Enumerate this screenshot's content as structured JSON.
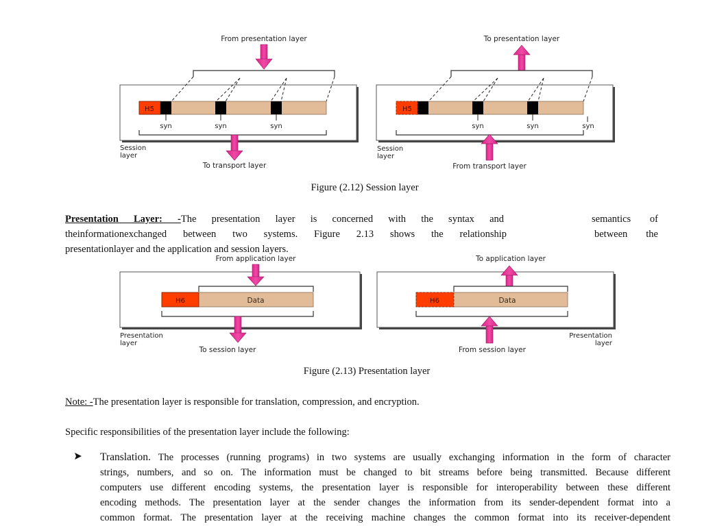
{
  "figure_2_12": {
    "left": {
      "top_label": "From presentation layer",
      "bottom_label": "To transport layer",
      "box_label_line1": "Session",
      "box_label_line2": "layer",
      "header": "H5",
      "syn_labels": [
        "syn",
        "syn",
        "syn"
      ]
    },
    "right": {
      "top_label": "To presentation layer",
      "bottom_label": "From transport layer",
      "box_label_line1": "Session",
      "box_label_line2": "layer",
      "header": "H5",
      "syn_labels": [
        "syn",
        "syn",
        "syn"
      ]
    },
    "caption": "Figure (2.12) Session layer"
  },
  "presentation_paragraph": {
    "heading": "Presentation Layer: -",
    "line1_a": "The presentation layer is concerned with the syntax and",
    "line1_b": "semantics of",
    "line2_a": "theinformationexchanged between two systems. Figure 2.13 shows the relationship",
    "line2_b": "between the",
    "line3": "presentationlayer and the application and session layers."
  },
  "figure_2_13": {
    "left": {
      "top_label": "From application layer",
      "bottom_label": "To session layer",
      "box_label_line1": "Presentation",
      "box_label_line2": "layer",
      "header": "H6",
      "data": "Data"
    },
    "right": {
      "top_label": "To application layer",
      "bottom_label": "From session layer",
      "box_label_line1": "Presentation",
      "box_label_line2": "layer",
      "header": "H6",
      "data": "Data"
    },
    "caption": "Figure (2.13) Presentation layer"
  },
  "note": {
    "label": "Note: -",
    "text": "The presentation layer is responsible for translation, compression, and encryption."
  },
  "responsibilities_intro": "Specific responsibilities of the presentation layer include the following:",
  "bullets": [
    {
      "icon": "arrowhead-bullet-icon",
      "title": "Translation.",
      "lines": [
        "The processes (running programs) in two systems are usually exchanging information in the form of character",
        "strings, numbers, and so on. The information must be changed to bit streams before being transmitted. Because different",
        "computers use different encoding systems, the presentation layer is responsible for interoperability between these different",
        "encoding methods. The presentation layer at the sender changes the information from its sender-dependent format into a",
        "common format. The presentation layer at the receiving machine changes the common format into its receiver-dependent"
      ]
    }
  ],
  "colors": {
    "header_red": "#ff3d00",
    "payload_tan": "#e2bc99",
    "sync_black": "#000000",
    "arrow_pink": "#e8399a"
  }
}
